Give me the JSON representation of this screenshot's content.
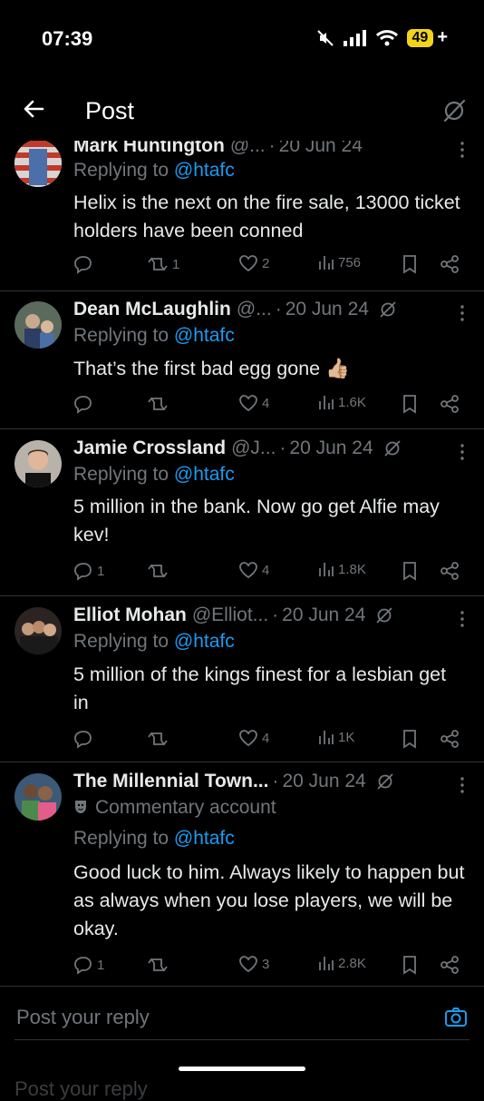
{
  "status_bar": {
    "time": "07:39",
    "battery": "49",
    "battery_suffix": "+"
  },
  "header": {
    "title": "Post"
  },
  "replies": [
    {
      "name": "Mark Huntington",
      "handle": "@...",
      "date": "20 Jun 24",
      "replying_prefix": "Replying to ",
      "mention": "@htafc",
      "text": "Helix is the next on the fire sale, 13000 ticket holders have been conned",
      "replies": "",
      "reposts": "1",
      "likes": "2",
      "views": "756"
    },
    {
      "name": "Dean McLaughlin",
      "handle": "@...",
      "date": "20 Jun 24",
      "replying_prefix": "Replying to ",
      "mention": "@htafc",
      "text": "That’s the first bad egg gone 👍🏼",
      "replies": "",
      "reposts": "",
      "likes": "4",
      "views": "1.6K"
    },
    {
      "name": "Jamie Crossland",
      "handle": "@J...",
      "date": "20 Jun 24",
      "replying_prefix": "Replying to ",
      "mention": "@htafc",
      "text": "5 million in the bank. Now go get Alfie may kev!",
      "replies": "1",
      "reposts": "",
      "likes": "4",
      "views": "1.8K"
    },
    {
      "name": "Elliot Mohan",
      "handle": "@Elliot...",
      "date": "20 Jun 24",
      "replying_prefix": "Replying to ",
      "mention": "@htafc",
      "text": "5 million of the kings finest for a lesbian get in",
      "replies": "",
      "reposts": "",
      "likes": "4",
      "views": "1K"
    },
    {
      "name": "The Millennial Town...",
      "handle": "",
      "date": "20 Jun 24",
      "commentary": "Commentary account",
      "replying_prefix": "Replying to ",
      "mention": "@htafc",
      "text": "Good luck to him. Always likely to happen but as always when you lose players, we will be okay.",
      "replies": "1",
      "reposts": "",
      "likes": "3",
      "views": "2.8K"
    }
  ],
  "composer": {
    "placeholder": "Post your reply",
    "ghost_text": "Post your reply"
  },
  "colors": {
    "accent": "#1d9bf0",
    "muted": "#71767b",
    "text": "#e7e9ea",
    "divider": "#2f3336",
    "battery": "#f2d41d"
  }
}
